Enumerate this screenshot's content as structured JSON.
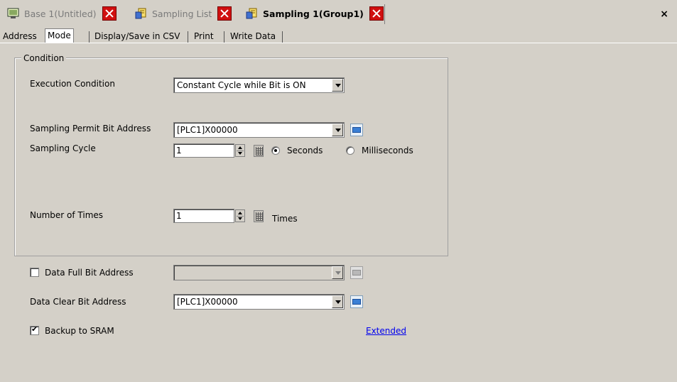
{
  "doc_tabs": [
    {
      "label": "Base 1(Untitled)",
      "active": false
    },
    {
      "label": "Sampling List",
      "active": false
    },
    {
      "label": "Sampling 1(Group1)",
      "active": true
    }
  ],
  "window_close": "×",
  "sub_tabs": [
    {
      "label": "Address"
    },
    {
      "label": "Mode"
    },
    {
      "label": "Display/Save in CSV"
    },
    {
      "label": "Print"
    },
    {
      "label": "Write Data"
    }
  ],
  "condition": {
    "group_label": "Condition",
    "execution_condition": {
      "label": "Execution Condition",
      "value": "Constant Cycle while Bit is ON"
    },
    "permit_bit": {
      "label": "Sampling Permit Bit Address",
      "value": "[PLC1]X00000"
    },
    "cycle": {
      "label": "Sampling Cycle",
      "value": "1",
      "unit_seconds": "Seconds",
      "unit_ms": "Milliseconds",
      "selected": "Seconds"
    },
    "times": {
      "label": "Number of Times",
      "value": "1",
      "unit": "Times"
    }
  },
  "data_full": {
    "label": "Data Full Bit Address",
    "checked": false,
    "value": ""
  },
  "data_clear": {
    "label": "Data Clear Bit Address",
    "value": "[PLC1]X00000"
  },
  "backup": {
    "label": "Backup to SRAM",
    "checked": true
  },
  "extended_link": "Extended",
  "colors": {
    "background": "#d4d0c8",
    "close_red": "#d01010",
    "link": "#0000ee"
  }
}
